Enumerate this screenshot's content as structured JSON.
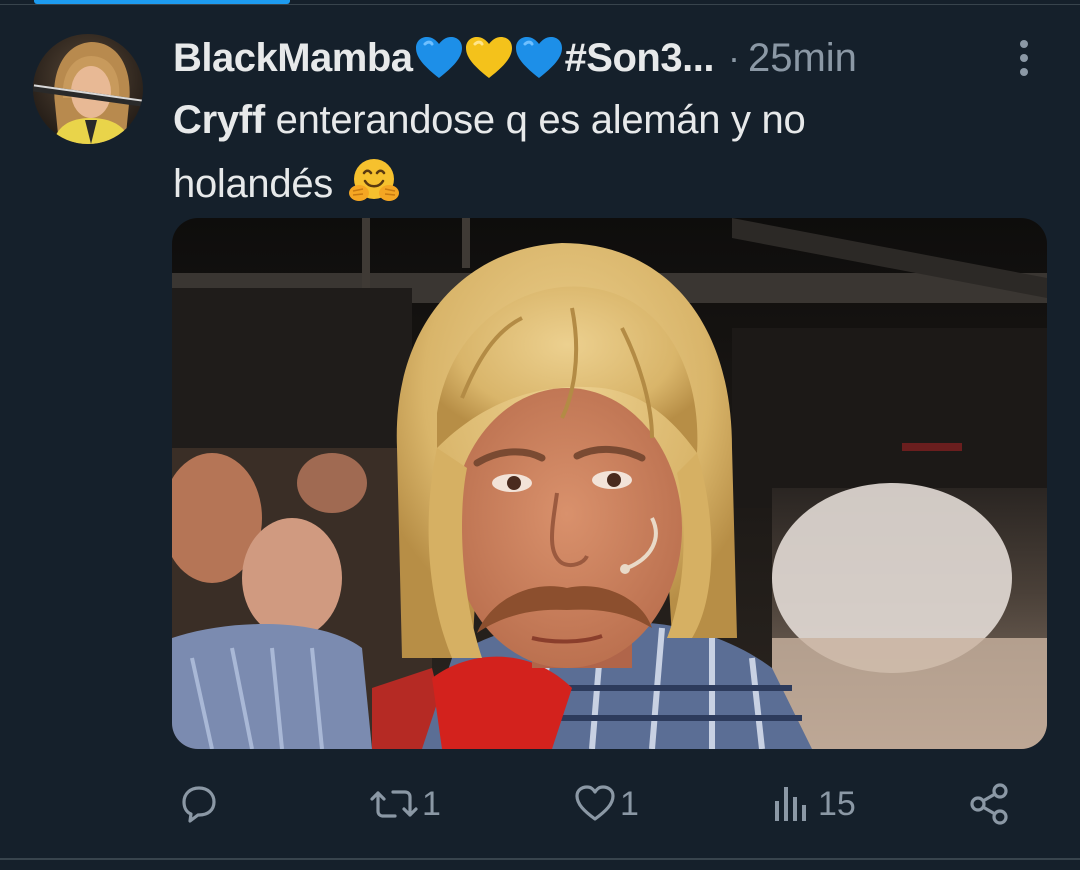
{
  "tweet": {
    "author": {
      "display_name": "BlackMamba",
      "name_emojis": [
        "blue-heart-emoji",
        "yellow-heart-emoji",
        "blue-heart-emoji"
      ],
      "hashtag_truncated": "#Son3...",
      "avatar_icon": "avatar-photo"
    },
    "separator": "·",
    "timestamp": "25min",
    "text": {
      "mention_bold": "Cryff",
      "line1_rest": " enterandose q es alemán y no",
      "line2": "holandés",
      "emoji": "hugging-face-emoji"
    },
    "media": {
      "kind": "photo"
    },
    "actions": {
      "reply": {
        "icon": "reply-icon",
        "count": ""
      },
      "retweet": {
        "icon": "retweet-icon",
        "count": "1"
      },
      "like": {
        "icon": "heart-icon",
        "count": "1"
      },
      "views": {
        "icon": "views-icon",
        "count": "15"
      },
      "share": {
        "icon": "share-icon",
        "count": ""
      }
    },
    "more_icon": "more-vertical-icon"
  },
  "colors": {
    "background": "#15202b",
    "text_primary": "#e7e9ea",
    "text_secondary": "#8b98a5",
    "accent": "#1d9bf0",
    "divider": "#38444d"
  }
}
